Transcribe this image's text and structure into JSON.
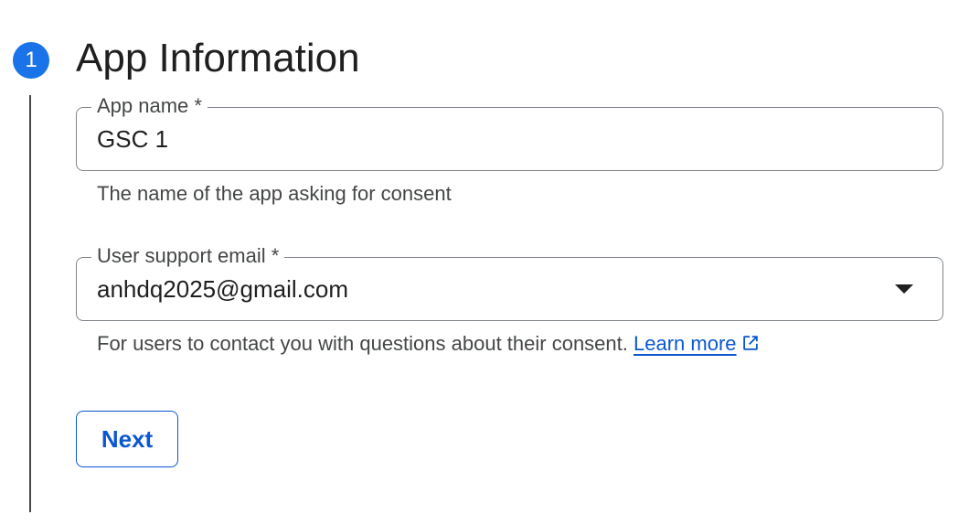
{
  "step": {
    "number": "1",
    "title": "App Information"
  },
  "app_name": {
    "label": "App name *",
    "value": "GSC 1",
    "hint": "The name of the app asking for consent"
  },
  "user_support_email": {
    "label": "User support email *",
    "selected": "anhdq2025@gmail.com",
    "hint": "For users to contact you with questions about their consent.",
    "link_text": "Learn more",
    "dropdown_icon": "arrow-drop-down-icon",
    "link_icon": "open-in-new-icon"
  },
  "actions": {
    "next_label": "Next"
  },
  "colors": {
    "accent": "#1a73e8",
    "link": "#0b57d0",
    "text": "#1f1f1f",
    "muted": "#444746",
    "outline": "#80868b"
  }
}
